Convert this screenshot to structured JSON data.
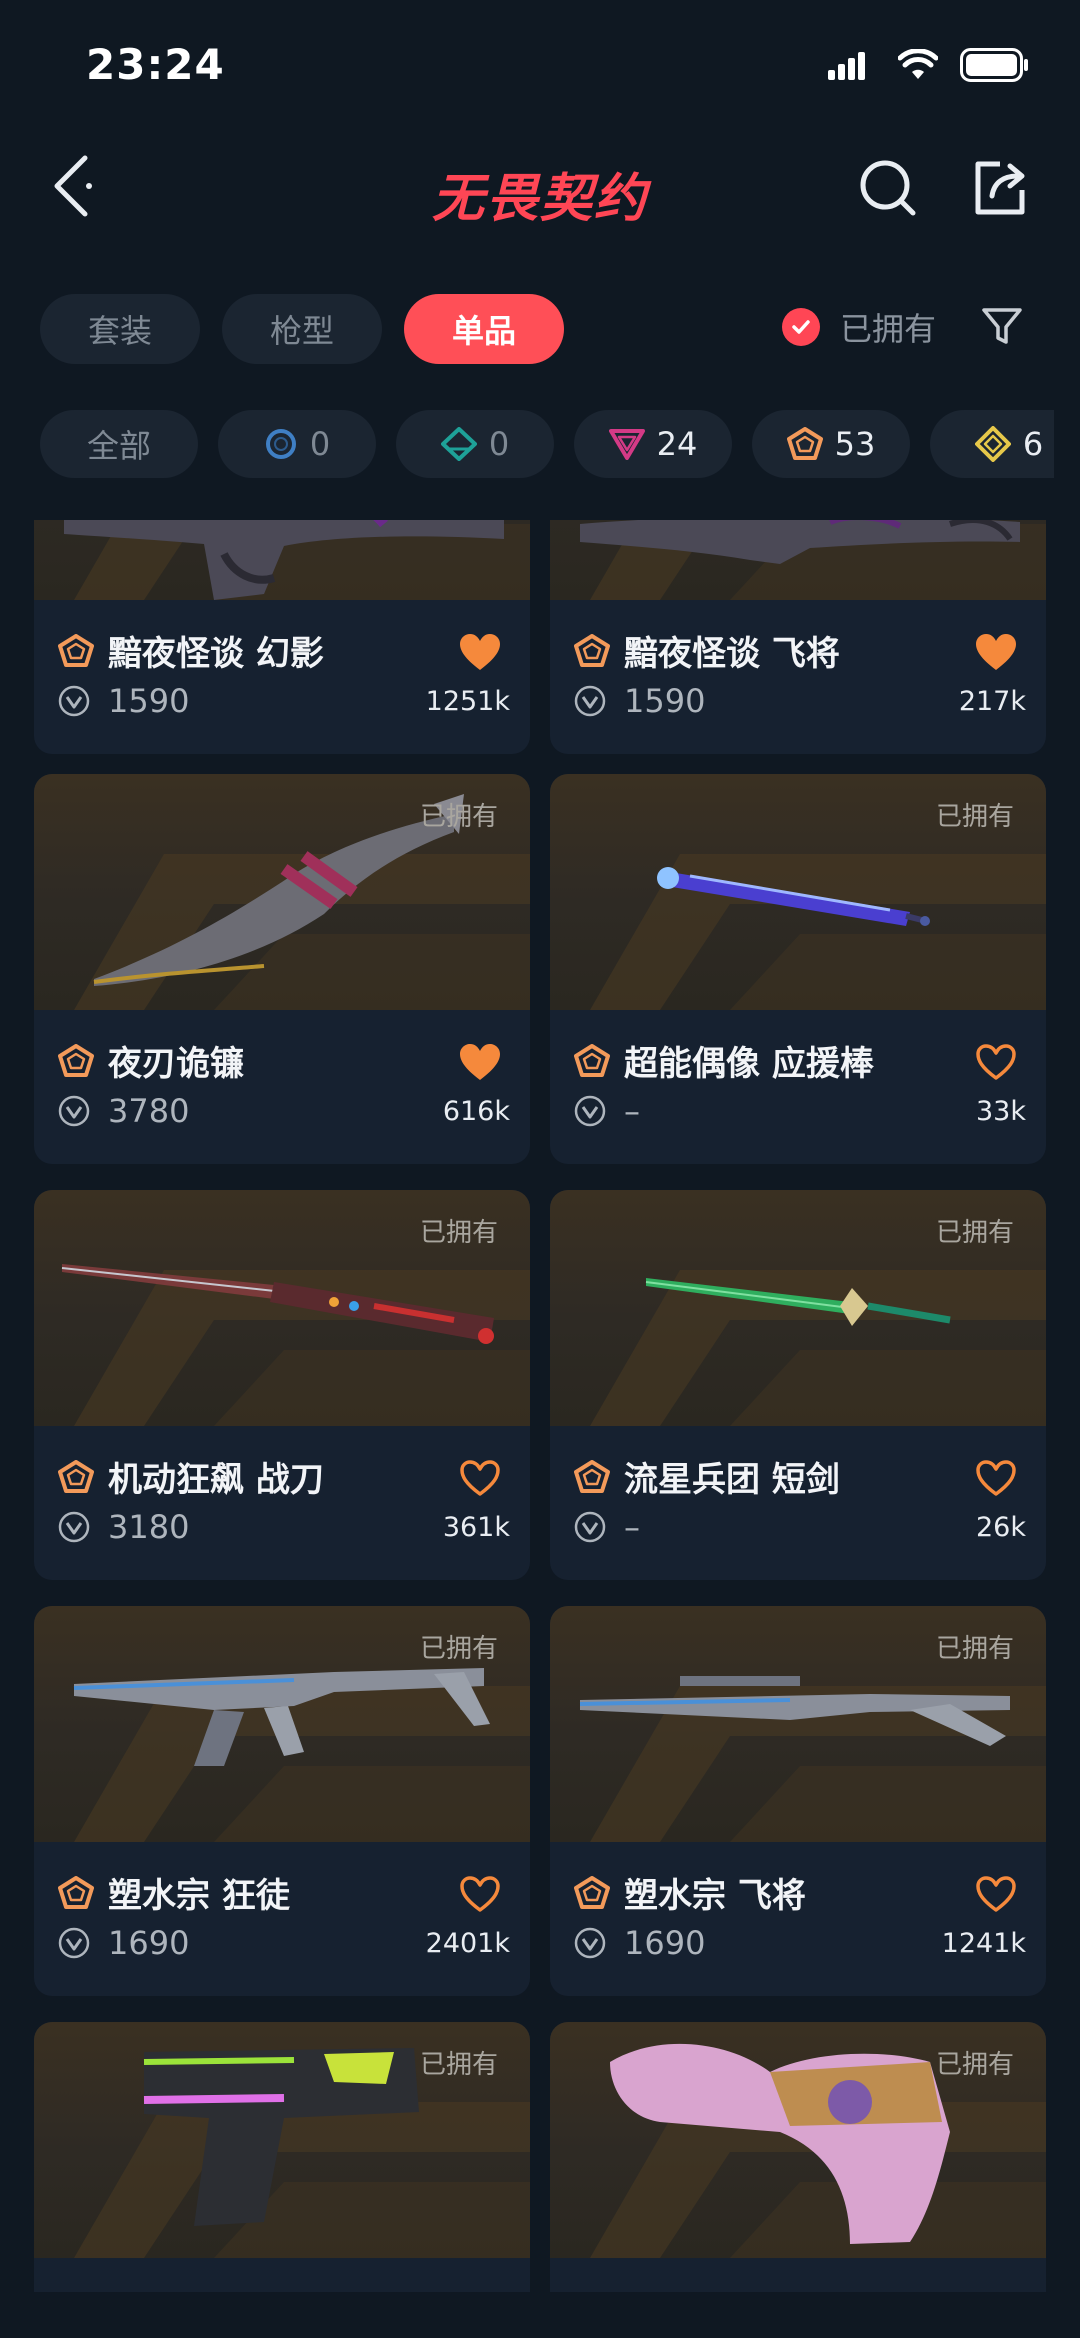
{
  "status": {
    "time": "23:24"
  },
  "header": {
    "title": "无畏契约"
  },
  "tabs": [
    {
      "label": "套装",
      "active": false
    },
    {
      "label": "枪型",
      "active": false
    },
    {
      "label": "单品",
      "active": true
    }
  ],
  "owned_filter": {
    "label": "已拥有",
    "checked": true
  },
  "chips": [
    {
      "label": "全部"
    },
    {
      "icon": "ring-tier-icon",
      "count": "0"
    },
    {
      "icon": "teal-diamond-tier-icon",
      "count": "0"
    },
    {
      "icon": "pink-triangle-tier-icon",
      "count": "24"
    },
    {
      "icon": "orange-pentagon-tier-icon",
      "count": "53"
    },
    {
      "icon": "yellow-diamond-tier-icon",
      "count": "6"
    }
  ],
  "cards": [
    {
      "name": "黯夜怪谈 幻影",
      "price": "1590",
      "likes": "1251k",
      "liked": true,
      "owned": false,
      "owned_label": ""
    },
    {
      "name": "黯夜怪谈 飞将",
      "price": "1590",
      "likes": "217k",
      "liked": true,
      "owned": false,
      "owned_label": ""
    },
    {
      "name": "夜刃诡镰",
      "price": "3780",
      "likes": "616k",
      "liked": true,
      "owned": true,
      "owned_label": "已拥有"
    },
    {
      "name": "超能偶像 应援棒",
      "price": "–",
      "likes": "33k",
      "liked": false,
      "owned": true,
      "owned_label": "已拥有"
    },
    {
      "name": "机动狂飙 战刀",
      "price": "3180",
      "likes": "361k",
      "liked": false,
      "owned": true,
      "owned_label": "已拥有"
    },
    {
      "name": "流星兵团 短剑",
      "price": "–",
      "likes": "26k",
      "liked": false,
      "owned": true,
      "owned_label": "已拥有"
    },
    {
      "name": "塑水宗 狂徒",
      "price": "1690",
      "likes": "2401k",
      "liked": false,
      "owned": true,
      "owned_label": "已拥有"
    },
    {
      "name": "塑水宗 飞将",
      "price": "1690",
      "likes": "1241k",
      "liked": false,
      "owned": true,
      "owned_label": "已拥有"
    },
    {
      "name": "",
      "price": "",
      "likes": "",
      "liked": false,
      "owned": true,
      "owned_label": "已拥有"
    },
    {
      "name": "",
      "price": "",
      "likes": "",
      "liked": false,
      "owned": true,
      "owned_label": "已拥有"
    }
  ],
  "colors": {
    "accent": "#ff4655",
    "tier_orange": "#f39a5a",
    "heart": "#f5893c",
    "bg": "#0f1822",
    "card": "#162130"
  }
}
